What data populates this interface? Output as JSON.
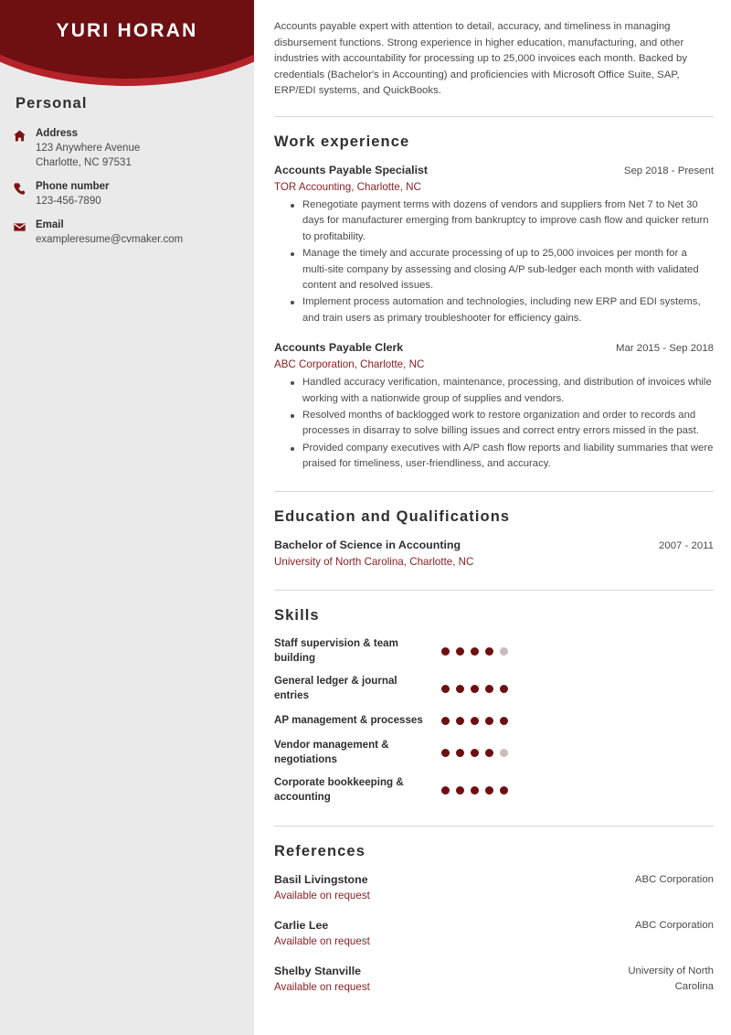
{
  "colors": {
    "banner_dark": "#6e0f11",
    "banner_light": "#b5232a",
    "sidebar_bg": "#eaeaea",
    "accent_text": "#8a2226",
    "dot_on": "#6e0f11",
    "dot_off": "#ccbcbd",
    "body_text": "#4a4a4a",
    "heading_text": "#2f2f2f"
  },
  "header": {
    "name": "YURI HORAN"
  },
  "sidebar": {
    "section_title": "Personal",
    "contacts": [
      {
        "icon": "home-icon",
        "label": "Address",
        "line1": "123 Anywhere Avenue",
        "line2": "Charlotte, NC 97531"
      },
      {
        "icon": "phone-icon",
        "label": "Phone number",
        "line1": "123-456-7890",
        "line2": ""
      },
      {
        "icon": "envelope-icon",
        "label": "Email",
        "line1": "exampleresume@cvmaker.com",
        "line2": ""
      }
    ]
  },
  "main": {
    "summary": "Accounts payable expert with attention to detail, accuracy, and timeliness in managing disbursement functions. Strong experience in higher education, manufacturing, and other industries with accountability for processing up to 25,000 invoices each month. Backed by credentials (Bachelor's in Accounting) and proficiencies with Microsoft Office Suite, SAP, ERP/EDI systems, and QuickBooks.",
    "work": {
      "title": "Work experience",
      "entries": [
        {
          "job_title": "Accounts Payable Specialist",
          "date": "Sep 2018 - Present",
          "organization": "TOR Accounting, Charlotte, NC",
          "bullets": [
            "Renegotiate payment terms with dozens of vendors and suppliers from Net 7 to Net 30 days for manufacturer emerging from bankruptcy to improve cash flow and quicker return to profitability.",
            "Manage the timely and accurate processing of up to 25,000 invoices per month for a multi-site company by assessing and closing A/P sub-ledger each month with validated content and resolved issues.",
            "Implement process automation and technologies, including new ERP and EDI systems, and train users as primary troubleshooter for efficiency gains."
          ]
        },
        {
          "job_title": "Accounts Payable Clerk",
          "date": "Mar 2015 - Sep 2018",
          "organization": "ABC Corporation, Charlotte, NC",
          "bullets": [
            "Handled accuracy verification, maintenance, processing, and distribution of invoices while working with a nationwide group of supplies and vendors.",
            "Resolved months of backlogged work to restore organization and order to records and processes in disarray to solve billing issues and correct entry errors missed in the past.",
            "Provided company executives with A/P cash flow reports and liability summaries that were praised for timeliness, user-friendliness, and accuracy."
          ]
        }
      ]
    },
    "education": {
      "title": "Education and Qualifications",
      "entries": [
        {
          "degree": "Bachelor of Science in Accounting",
          "date": "2007 - 2011",
          "institution": "University of North Carolina, Charlotte, NC"
        }
      ]
    },
    "skills": {
      "title": "Skills",
      "max_rating": 5,
      "items": [
        {
          "name": "Staff supervision & team building",
          "rating": 4
        },
        {
          "name": "General ledger & journal entries",
          "rating": 5
        },
        {
          "name": "AP management & processes",
          "rating": 5
        },
        {
          "name": "Vendor management & negotiations",
          "rating": 4
        },
        {
          "name": "Corporate bookkeeping & accounting",
          "rating": 5
        }
      ]
    },
    "references": {
      "title": "References",
      "items": [
        {
          "name": "Basil Livingstone",
          "status": "Available on request",
          "company": "ABC Corporation"
        },
        {
          "name": "Carlie Lee",
          "status": "Available on request",
          "company": "ABC Corporation"
        },
        {
          "name": "Shelby Stanville",
          "status": "Available on request",
          "company": "University of North Carolina"
        }
      ]
    }
  }
}
